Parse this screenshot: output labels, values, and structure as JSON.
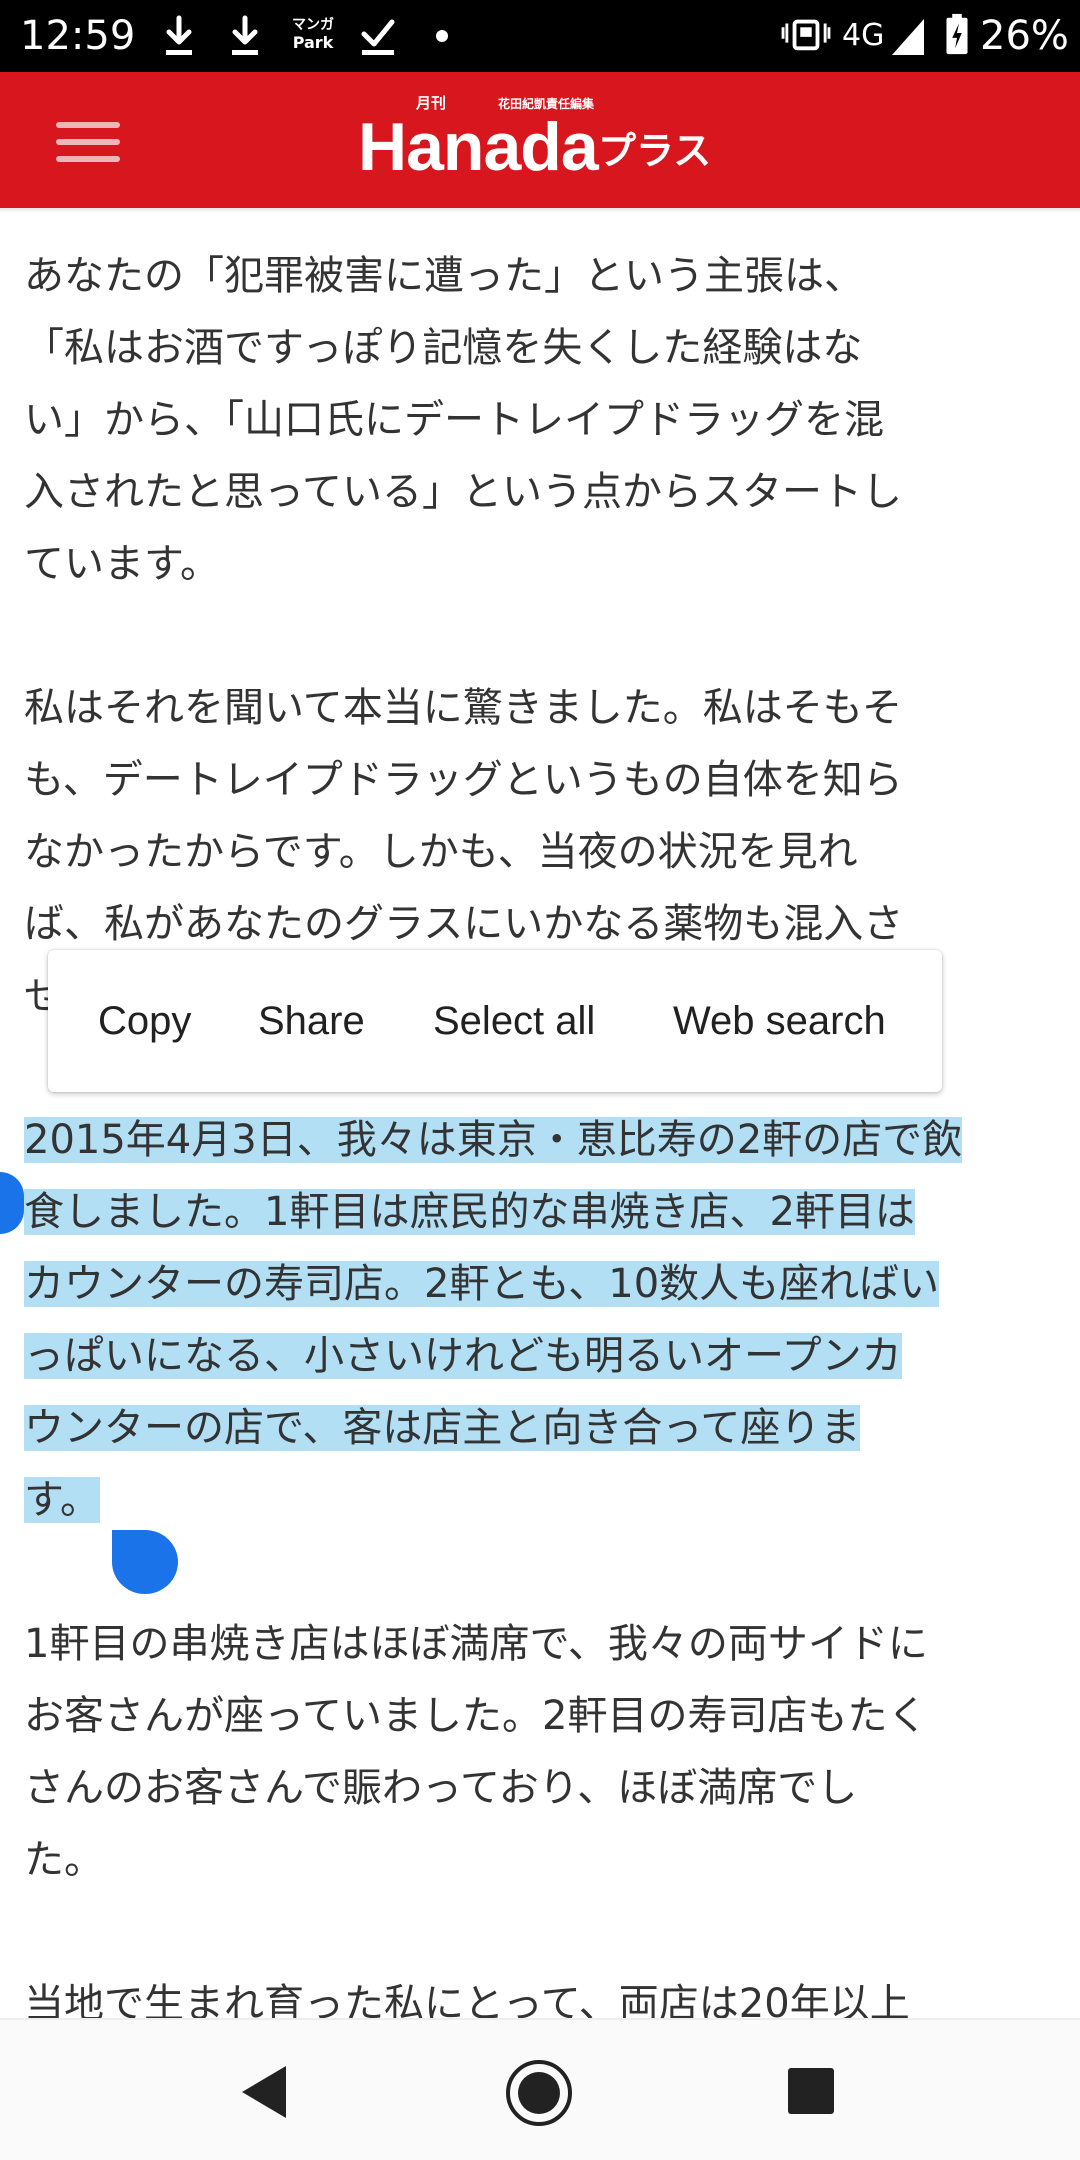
{
  "status_bar": {
    "time": "12:59",
    "network": "4G",
    "battery": "26%",
    "icons": [
      "download-icon",
      "download-icon",
      "manga-park-icon",
      "task-done-icon",
      "notification-dot-icon",
      "vibrate-icon",
      "signal-icon",
      "battery-charging-icon"
    ],
    "manga_park_line1": "マンガ",
    "manga_park_line2": "Park"
  },
  "header": {
    "logo_main": "Hanada",
    "logo_suffix": "プラス",
    "logo_tag": "月刊",
    "logo_editor": "花田紀凱責任編集",
    "background_color": "#d7161e"
  },
  "article": {
    "paragraphs": [
      {
        "lines": [
          "あなたの「犯罪被害に遭った」という主張は、",
          "「私はお酒ですっぽり記憶を失くした経験はな",
          "い」から、「山口氏にデートレイプドラッグを混",
          "入されたと思っている」という点からスタートし",
          "ています。"
        ]
      },
      {
        "lines": [
          "私はそれを聞いて本当に驚きました。私はそもそ",
          "も、デートレイプドラッグというもの自体を知ら",
          "なかったからです。しかも、当夜の状況を見れ",
          "ば、私があなたのグラスにいかなる薬物も混入さ",
          "せ"
        ]
      },
      {
        "selected": true,
        "lines": [
          "2015年4月3日、我々は東京・恵比寿の2軒の店で飲",
          "食しました。1軒目は庶民的な串焼き店、2軒目は",
          "カウンターの寿司店。2軒とも、10数人も座ればい",
          "っぱいになる、小さいけれども明るいオープンカ",
          "ウンターの店で、客は店主と向き合って座りま",
          "す。"
        ]
      },
      {
        "lines": [
          "1軒目の串焼き店はほぼ満席で、我々の両サイドに",
          "お客さんが座っていました。2軒目の寿司店もたく",
          "さんのお客さんで賑わっており、ほぼ満席でし",
          "た。"
        ]
      },
      {
        "lines": [
          "当地で生まれ育った私にとって、両店は20年以上"
        ]
      }
    ]
  },
  "context_menu": {
    "copy": "Copy",
    "share": "Share",
    "select_all": "Select all",
    "web_search": "Web search"
  },
  "nav_bar": {
    "back": "back-icon",
    "home": "home-icon",
    "recents": "recents-icon"
  },
  "colors": {
    "selection_highlight": "#b3dff5",
    "selection_handle": "#1a73e8",
    "body_text": "#333333"
  }
}
